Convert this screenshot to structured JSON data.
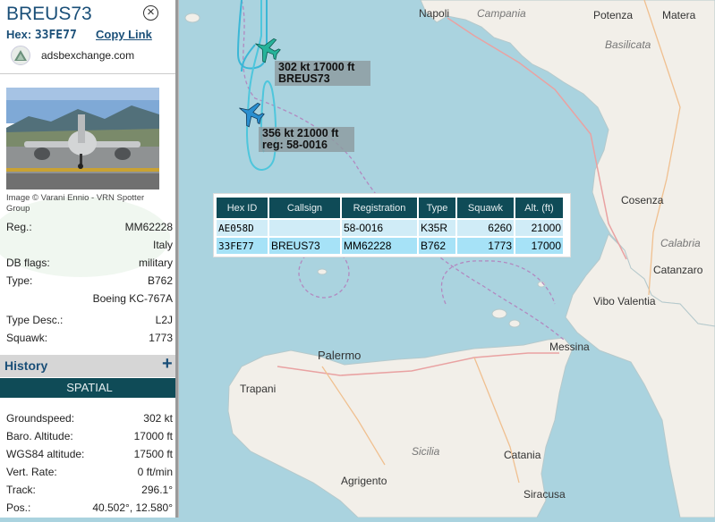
{
  "aircraft": {
    "callsign": "BREUS73",
    "hex_label": "Hex:",
    "hex": "33FE77",
    "copy_link": "Copy Link",
    "source": "adsbexchange.com",
    "photo_credit": "Image © Varani Ennio - VRN Spotter Group"
  },
  "details": [
    {
      "label": "Reg.:",
      "value": "MM62228"
    },
    {
      "label": "",
      "value": "Italy"
    },
    {
      "label": "DB flags:",
      "value": "military"
    },
    {
      "label": "Type:",
      "value": "B762"
    },
    {
      "label": "",
      "value": "Boeing KC-767A"
    },
    {
      "label": "Type Desc.:",
      "value": "L2J"
    },
    {
      "label": "Squawk:",
      "value": "1773"
    }
  ],
  "history": {
    "label": "History",
    "plus": "+"
  },
  "spatial": {
    "label": "SPATIAL",
    "rows": [
      {
        "label": "Groundspeed:",
        "value": "302 kt"
      },
      {
        "label": "Baro. Altitude:",
        "value": "17000 ft"
      },
      {
        "label": "WGS84 altitude:",
        "value": "17500 ft"
      },
      {
        "label": "Vert. Rate:",
        "value": "0 ft/min"
      },
      {
        "label": "Track:",
        "value": "296.1°"
      },
      {
        "label": "Pos.:",
        "value": "40.502°, 12.580°"
      }
    ]
  },
  "labels": {
    "a": {
      "line1": "302 kt  17000 ft",
      "line2": "BREUS73"
    },
    "b": {
      "line1": "356 kt  21000 ft",
      "line2": "reg: 58-0016"
    }
  },
  "table": {
    "headers": [
      "Hex ID",
      "Callsign",
      "Registration",
      "Type",
      "Squawk",
      "Alt. (ft)"
    ],
    "rows": [
      [
        "AE058D",
        "",
        "58-0016",
        "K35R",
        "6260",
        "21000"
      ],
      [
        "33FE77",
        "BREUS73",
        "MM62228",
        "B762",
        "1773",
        "17000"
      ]
    ]
  },
  "map_labels": {
    "napoli": "Napoli",
    "campania": "Campania",
    "potenza": "Potenza",
    "matera": "Matera",
    "basilicata": "Basilicata",
    "cosenza": "Cosenza",
    "calabria": "Calabria",
    "catanzaro": "Catanzaro",
    "vibo": "Vibo Valentia",
    "palermo": "Palermo",
    "messina": "Messina",
    "trapani": "Trapani",
    "sicilia": "Sicilia",
    "agrigento": "Agrigento",
    "catania": "Catania",
    "siracusa": "Siracusa"
  },
  "colors": {
    "accent": "#0f4b57",
    "title": "#1a4f78",
    "track": "#3bb7d6",
    "selected_plane": "#26b39a",
    "other_plane": "#2a8fd0"
  }
}
